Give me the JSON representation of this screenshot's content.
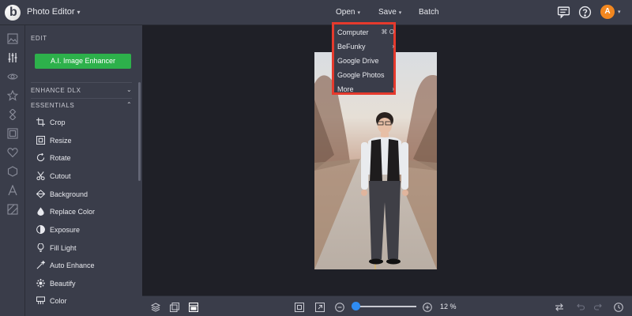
{
  "app": {
    "title": "Photo Editor",
    "logo_letter": "b"
  },
  "topbar": {
    "menus": [
      {
        "label": "Open"
      },
      {
        "label": "Save"
      },
      {
        "label": "Batch"
      }
    ],
    "avatar_letter": "A",
    "icons": [
      "message-icon",
      "help-icon"
    ]
  },
  "panel": {
    "edit_label": "EDIT",
    "ai_button": "A.I. Image Enhancer",
    "sections": [
      {
        "label": "ENHANCE DLX"
      },
      {
        "label": "ESSENTIALS"
      }
    ],
    "tools": [
      {
        "label": "Crop",
        "icon": "crop-icon"
      },
      {
        "label": "Resize",
        "icon": "resize-icon"
      },
      {
        "label": "Rotate",
        "icon": "rotate-icon"
      },
      {
        "label": "Cutout",
        "icon": "scissors-icon"
      },
      {
        "label": "Background",
        "icon": "background-icon"
      },
      {
        "label": "Replace Color",
        "icon": "droplet-icon"
      },
      {
        "label": "Exposure",
        "icon": "exposure-icon"
      },
      {
        "label": "Fill Light",
        "icon": "bulb-icon"
      },
      {
        "label": "Auto Enhance",
        "icon": "wand-icon"
      },
      {
        "label": "Beautify",
        "icon": "sparkle-icon"
      },
      {
        "label": "Color",
        "icon": "color-icon"
      }
    ]
  },
  "dropdown": {
    "items": [
      {
        "label": "Computer",
        "extra": "⌘ O"
      },
      {
        "label": "BeFunky",
        "extra": "›"
      },
      {
        "label": "Google Drive",
        "extra": ""
      },
      {
        "label": "Google Photos",
        "extra": ""
      },
      {
        "label": "More",
        "extra": "›"
      }
    ]
  },
  "bottombar": {
    "zoom_label": "12 %",
    "zoom_level": 0.05
  },
  "colors": {
    "accent_green": "#2db14b",
    "highlight_red": "#e53a2d",
    "accent_blue": "#2f8cf2",
    "avatar_orange": "#f2871f"
  }
}
